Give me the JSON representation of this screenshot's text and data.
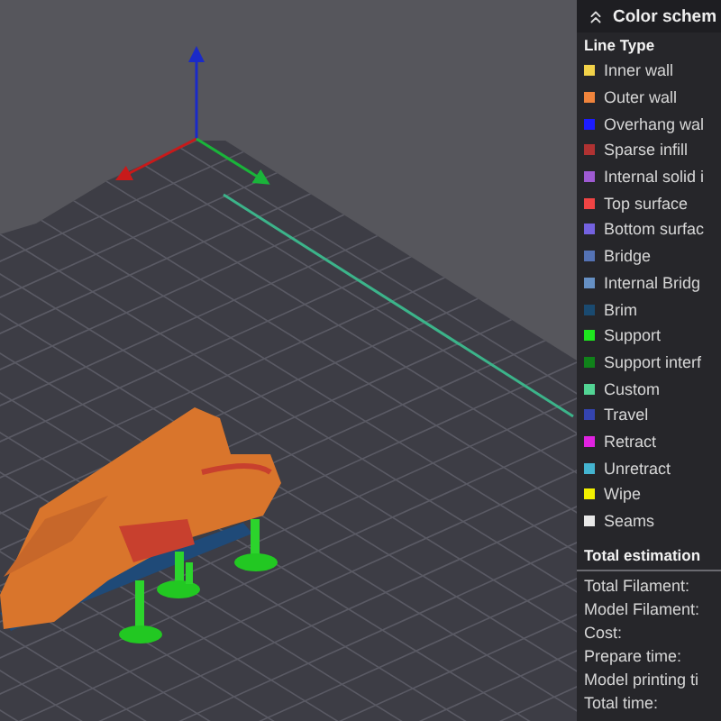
{
  "panel": {
    "title": "Color schem"
  },
  "legend": {
    "heading": "Line Type",
    "items": [
      {
        "label": "Inner wall",
        "color": "#f2d249"
      },
      {
        "label": "Outer wall",
        "color": "#f0843c"
      },
      {
        "label": "Overhang wal",
        "color": "#1c1cff"
      },
      {
        "label": "Sparse infill",
        "color": "#b03232"
      },
      {
        "label": "Internal solid i",
        "color": "#9e5ad2"
      },
      {
        "label": "Top surface",
        "color": "#f04444"
      },
      {
        "label": "Bottom surfac",
        "color": "#7462e0"
      },
      {
        "label": "Bridge",
        "color": "#5472b4"
      },
      {
        "label": "Internal Bridg",
        "color": "#6690c4"
      },
      {
        "label": "Brim",
        "color": "#1a4a70"
      },
      {
        "label": "Support",
        "color": "#1ee61e"
      },
      {
        "label": "Support interf",
        "color": "#10821a"
      },
      {
        "label": "Custom",
        "color": "#52d494"
      },
      {
        "label": "Travel",
        "color": "#3444b0"
      },
      {
        "label": "Retract",
        "color": "#e022e0"
      },
      {
        "label": "Unretract",
        "color": "#44b4d0"
      },
      {
        "label": "Wipe",
        "color": "#f2f000"
      },
      {
        "label": "Seams",
        "color": "#e8e8e8"
      }
    ]
  },
  "estimation": {
    "heading": "Total estimation",
    "rows": [
      "Total Filament:",
      "Model Filament:",
      "Cost:",
      "Prepare time:",
      "Model printing ti",
      "Total time:"
    ]
  }
}
